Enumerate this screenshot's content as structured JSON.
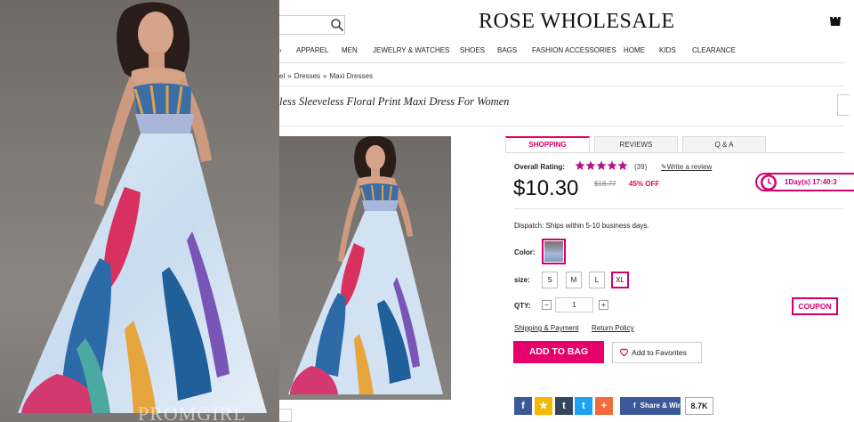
{
  "brand": {
    "logo": "ROSE WHOLESALE"
  },
  "nav": {
    "items": [
      "APPAREL",
      "MEN",
      "JEWELRY & WATCHES",
      "SHOES",
      "BAGS",
      "FASHION ACCESSORIES",
      "HOME",
      "KIDS",
      "CLEARANCE"
    ]
  },
  "breadcrumb": [
    "el",
    "Dresses",
    "Maxi Dresses"
  ],
  "product": {
    "title": "less Sleeveless Floral Print Maxi Dress For Women"
  },
  "watermark": "PROMGIRL",
  "tabs": [
    "SHOPPING",
    "REVIEWS",
    "Q & A"
  ],
  "rating": {
    "label": "Overall Rating:",
    "stars": 5,
    "count": "(39)",
    "write_review": "Write a review"
  },
  "price": {
    "current": "$10.30",
    "original": "$18.77",
    "discount": "45% OFF"
  },
  "timer": {
    "text": "1Day(s) 17:40:3"
  },
  "dispatch": "Dispatch: Ships within 5-10 business days.",
  "options": {
    "color_label": "Color:",
    "size_label": "size:",
    "sizes": [
      "S",
      "M",
      "L",
      "XL"
    ],
    "selected_size": "XL",
    "qty_label": "QTY:",
    "qty_value": "1"
  },
  "buttons": {
    "coupon": "COUPON",
    "add_to_bag": "ADD TO BAG",
    "add_to_favorites": "Add to Favorites"
  },
  "links": {
    "shipping": "Shipping & Payment",
    "return": "Return Policy"
  },
  "social": {
    "icons": [
      {
        "name": "facebook-icon",
        "glyph": "f",
        "color": "#3b5998"
      },
      {
        "name": "star-icon",
        "glyph": "★",
        "color": "#f5b800"
      },
      {
        "name": "tumblr-icon",
        "glyph": "t",
        "color": "#35465c"
      },
      {
        "name": "twitter-icon",
        "glyph": "t",
        "color": "#1da1f2"
      },
      {
        "name": "plus-icon",
        "glyph": "+",
        "color": "#f26b3a"
      }
    ],
    "share_label": "Share & Win",
    "count": "8.7K"
  },
  "colors": {
    "accent": "#e5006a",
    "accent_dark": "#d6006b",
    "star": "#b3157f"
  }
}
